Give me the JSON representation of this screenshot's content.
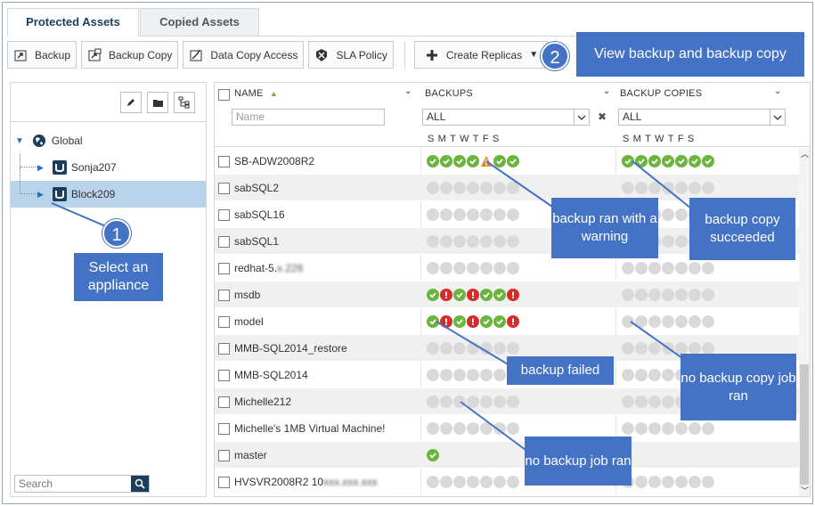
{
  "tabs": [
    {
      "label": "Protected Assets",
      "active": true
    },
    {
      "label": "Copied Assets",
      "active": false
    }
  ],
  "toolbar": {
    "backup": "Backup",
    "backup_copy": "Backup Copy",
    "data_copy_access": "Data Copy Access",
    "sla_policy": "SLA Policy",
    "create_replicas": "Create Replicas"
  },
  "tree": {
    "root": "Global",
    "children": [
      "Sonja207",
      "Block209"
    ],
    "selected": "Block209"
  },
  "search": {
    "placeholder": "Search"
  },
  "grid": {
    "col_name": "NAME",
    "col_backups": "BACKUPS",
    "col_copies": "BACKUP COPIES",
    "name_placeholder": "Name",
    "filter_all": "ALL",
    "days": "SMTWTFS"
  },
  "rows": [
    {
      "name": "SB-ADW2008R2",
      "backups": [
        "ok",
        "ok",
        "ok",
        "ok",
        "warn",
        "ok",
        "ok"
      ],
      "copies": [
        "ok",
        "ok",
        "ok",
        "ok",
        "ok",
        "ok",
        "ok"
      ]
    },
    {
      "name": "sabSQL2",
      "backups": [
        "none",
        "none",
        "none",
        "none",
        "none",
        "none",
        "none"
      ],
      "copies": [
        "none",
        "none",
        "none",
        "none",
        "none",
        "none",
        "none"
      ]
    },
    {
      "name": "sabSQL16",
      "backups": [
        "none",
        "none",
        "none",
        "none",
        "none",
        "none",
        "none"
      ],
      "copies": [
        "none",
        "none",
        "none",
        "none",
        "none",
        "none",
        "none"
      ]
    },
    {
      "name": "sabSQL1",
      "backups": [
        "none",
        "none",
        "none",
        "none",
        "none",
        "none",
        "none"
      ],
      "copies": [
        "none",
        "none",
        "none",
        "none",
        "none",
        "none",
        "none"
      ]
    },
    {
      "name": "redhat-5.",
      "name_blurred": "x.226",
      "backups": [
        "none",
        "none",
        "none",
        "none",
        "none",
        "none",
        "none"
      ],
      "copies": [
        "none",
        "none",
        "none",
        "none",
        "none",
        "none",
        "none"
      ]
    },
    {
      "name": "msdb",
      "backups": [
        "ok",
        "fail",
        "ok",
        "fail",
        "ok",
        "ok",
        "fail"
      ],
      "copies": [
        "none",
        "none",
        "none",
        "none",
        "none",
        "none",
        "none"
      ]
    },
    {
      "name": "model",
      "backups": [
        "ok",
        "fail",
        "ok",
        "fail",
        "ok",
        "ok",
        "fail"
      ],
      "copies": [
        "none",
        "none",
        "none",
        "none",
        "none",
        "none",
        "none"
      ]
    },
    {
      "name": "MMB-SQL2014_restore",
      "backups": [
        "none",
        "none",
        "none",
        "none",
        "none",
        "none",
        "none"
      ],
      "copies": [
        "none",
        "none",
        "none",
        "none",
        "none",
        "none",
        "none"
      ]
    },
    {
      "name": "MMB-SQL2014",
      "backups": [
        "none",
        "none",
        "none",
        "none",
        "none",
        "none",
        "none"
      ],
      "copies": [
        "none",
        "none",
        "none",
        "none",
        "none",
        "none",
        "none"
      ]
    },
    {
      "name": "Michelle212",
      "backups": [
        "none",
        "none",
        "none",
        "none",
        "none",
        "none",
        "none"
      ],
      "copies": [
        "none",
        "none",
        "none",
        "none",
        "none",
        "none",
        "none"
      ]
    },
    {
      "name": "Michelle's 1MB Virtual Machine!",
      "backups": [
        "none",
        "none",
        "none",
        "none",
        "none",
        "none",
        "none"
      ],
      "copies": [
        "none",
        "none",
        "none",
        "none",
        "none",
        "none",
        "none"
      ]
    },
    {
      "name": "master",
      "backups": [
        "ok"
      ],
      "copies": []
    },
    {
      "name": "HVSVR2008R2 10",
      "name_blurred": "xxx.xxx.xxx",
      "backups": [
        "none",
        "none",
        "none",
        "none",
        "none",
        "none",
        "none"
      ],
      "copies": [
        "none",
        "none",
        "none",
        "none",
        "none",
        "none",
        "none"
      ]
    }
  ],
  "callouts": {
    "step1_num": "1",
    "step1_text": "Select an appliance",
    "step2_num": "2",
    "step2_text": "View backup and backup copy",
    "warning": "backup ran with a warning",
    "copy_ok": "backup copy succeeded",
    "failed": "backup failed",
    "no_copy": "no backup copy job ran",
    "no_backup": "no backup job ran"
  },
  "colors": {
    "ok": "#6bb53f",
    "fail": "#d52b2b",
    "warn": "#e08a2a",
    "none": "#d9d9d9",
    "callout": "#4472c4",
    "selected": "#b9d3ea"
  }
}
